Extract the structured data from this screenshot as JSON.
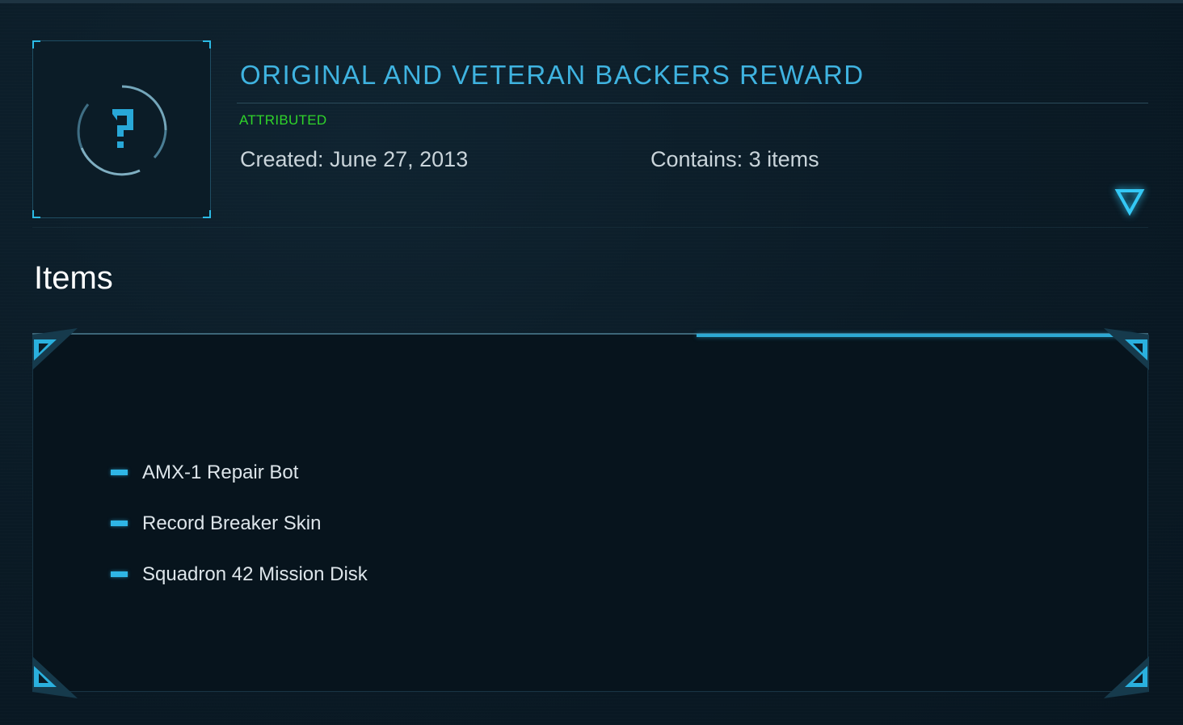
{
  "pledge": {
    "title": "ORIGINAL AND VETERAN BACKERS REWARD",
    "status": "ATTRIBUTED",
    "created": "Created: June 27, 2013",
    "contains": "Contains: 3 items",
    "thumbnail_icon": "question-mark-icon"
  },
  "section": {
    "title": "Items"
  },
  "items": [
    {
      "label": "AMX-1 Repair Bot"
    },
    {
      "label": "Record Breaker Skin"
    },
    {
      "label": "Squadron 42 Mission Disk"
    }
  ],
  "colors": {
    "accent": "#3fb3e0",
    "status": "#2fd42a",
    "background": "#0a1a25"
  }
}
